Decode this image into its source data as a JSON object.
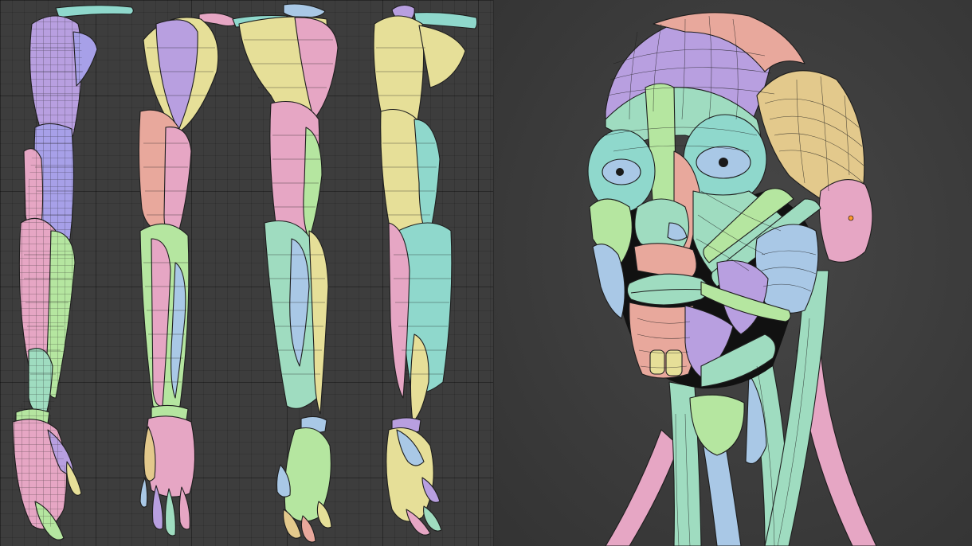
{
  "palette": {
    "purple": "#b89fe0",
    "lavender": "#a7a0e8",
    "pink": "#e6a6c4",
    "salmon": "#e8a89c",
    "mint": "#9fdcc0",
    "green": "#b5e6a0",
    "teal": "#8fd8cc",
    "yellow": "#e6df98",
    "tan": "#e3c98c",
    "blue": "#a9c8e6",
    "dark": "#111111"
  },
  "icons": {
    "eye_left": "eye-icon",
    "eye_right": "eye-icon",
    "origin": "origin-dot-icon"
  }
}
